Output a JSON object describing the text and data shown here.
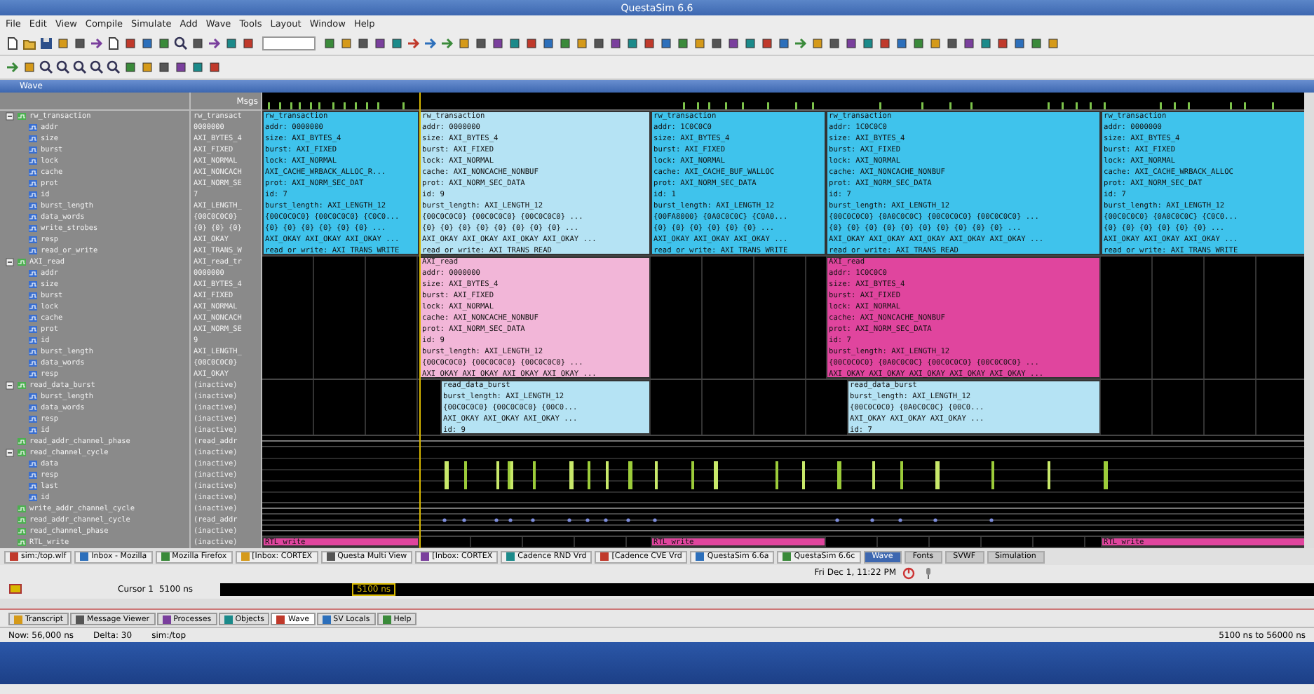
{
  "window": {
    "title": "QuestaSim 6.6"
  },
  "menu": [
    "File",
    "Edit",
    "View",
    "Compile",
    "Simulate",
    "Add",
    "Wave",
    "Tools",
    "Layout",
    "Window",
    "Help"
  ],
  "wave_window": {
    "title": "Wave",
    "value_header": "Msgs"
  },
  "signals": [
    {
      "name": "rw_transaction",
      "value": "rw_transact",
      "expanded": true,
      "wave": {
        "kind": "transactions",
        "segments": [
          {
            "kind": "transaction",
            "color": "#3fc3ec",
            "lines": [
              "rw_transaction",
              "addr: 0000000",
              "size: AXI_BYTES_4",
              "burst: AXI_FIXED",
              "lock: AXI_NORMAL",
              "AXI_CACHE_WRBACK_ALLOC_R...",
              "prot: AXI_NORM_SEC_DAT",
              "id: 7",
              "burst_length: AXI_LENGTH_12",
              "{00C0C0C0} {00C0C0C0} {C0C0...",
              "{0} {0} {0} {0} {0} {0} ...",
              "AXI_OKAY AXI_OKAY AXI_OKAY ...",
              "read_or_write: AXI_TRANS_WRITE"
            ]
          },
          {
            "kind": "transaction",
            "color": "#b5e3f4",
            "lines": [
              "rw_transaction",
              "addr: 0000000",
              "size: AXI_BYTES_4",
              "burst: AXI_FIXED",
              "lock: AXI_NORMAL",
              "cache: AXI_NONCACHE_NONBUF",
              "prot: AXI_NORM_SEC_DATA",
              "id: 9",
              "burst_length: AXI_LENGTH_12",
              "{00C0C0C0} {00C0C0C0} {00C0C0C0} ...",
              "{0} {0} {0} {0} {0} {0} {0} {0} ...",
              "AXI_OKAY AXI_OKAY AXI_OKAY AXI_OKAY ...",
              "read_or_write: AXI_TRANS_READ"
            ]
          },
          {
            "kind": "transaction",
            "color": "#3fc3ec",
            "lines": [
              "rw_transaction",
              "addr: 1C0C0C0",
              "size: AXI_BYTES_4",
              "burst: AXI_FIXED",
              "lock: AXI_NORMAL",
              "cache: AXI_CACHE_BUF_WALLOC",
              "prot: AXI_NORM_SEC_DATA",
              "id: 1",
              "burst_length: AXI_LENGTH_12",
              "{00FA8000} {0A0C0C0C} {C0A0...",
              "{0} {0} {0} {0} {0} {0} ...",
              "AXI_OKAY AXI_OKAY AXI_OKAY ...",
              "read_or_write: AXI_TRANS_WRITE"
            ]
          },
          {
            "kind": "transaction",
            "color": "#3fc3ec",
            "lines": [
              "rw_transaction",
              "addr: 1C0C0C0",
              "size: AXI_BYTES_4",
              "burst: AXI_FIXED",
              "lock: AXI_NORMAL",
              "cache: AXI_NONCACHE_NONBUF",
              "prot: AXI_NORM_SEC_DATA",
              "id: 7",
              "burst_length: AXI_LENGTH_12",
              "{00C0C0C0} {0A0C0C0C} {00C0C0C0} {00C0C0C0} ...",
              "{0} {0} {0} {0} {0} {0} {0} {0} {0} {0} ...",
              "AXI_OKAY AXI_OKAY AXI_OKAY AXI_OKAY AXI_OKAY ...",
              "read_or_write: AXI_TRANS_READ"
            ]
          },
          {
            "kind": "transaction",
            "color": "#3fc3ec",
            "lines": [
              "rw_transaction",
              "addr: 0000000",
              "size: AXI_BYTES_4",
              "burst: AXI_FIXED",
              "lock: AXI_NORMAL",
              "cache: AXI_CACHE_WRBACK_ALLOC",
              "prot: AXI_NORM_SEC_DAT",
              "id: 7",
              "burst_length: AXI_LENGTH_12",
              "{00C0C0C0} {0A0C0C0C} {C0C0...",
              "{0} {0} {0} {0} {0} {0} ...",
              "AXI_OKAY AXI_OKAY AXI_OKAY ...",
              "read_or_write: AXI_TRANS_WRITE"
            ]
          }
        ]
      },
      "children": [
        {
          "name": "addr",
          "value": "0000000"
        },
        {
          "name": "size",
          "value": "AXI_BYTES_4"
        },
        {
          "name": "burst",
          "value": "AXI_FIXED"
        },
        {
          "name": "lock",
          "value": "AXI_NORMAL"
        },
        {
          "name": "cache",
          "value": "AXI_NONCACH"
        },
        {
          "name": "prot",
          "value": "AXI_NORM_SE"
        },
        {
          "name": "id",
          "value": "7"
        },
        {
          "name": "burst_length",
          "value": "AXI_LENGTH_"
        },
        {
          "name": "data_words",
          "value": "{00C0C0C0}"
        },
        {
          "name": "write_strobes",
          "value": "{0} {0} {0}"
        },
        {
          "name": "resp",
          "value": "AXI_OKAY"
        },
        {
          "name": "read_or_write",
          "value": "AXI_TRANS_W"
        }
      ]
    },
    {
      "name": "AXI_read",
      "value": "AXI_read_tr",
      "expanded": true,
      "wave": {
        "kind": "transactions",
        "segments": [
          {
            "kind": "idle"
          },
          {
            "kind": "transaction",
            "color": "#f2b6d8",
            "lines": [
              "AXI_read",
              "addr: 0000000",
              "size: AXI_BYTES_4",
              "burst: AXI_FIXED",
              "lock: AXI_NORMAL",
              "cache: AXI_NONCACHE_NONBUF",
              "prot: AXI_NORM_SEC_DATA",
              "id: 9",
              "burst_length: AXI_LENGTH_12",
              "{00C0C0C0} {00C0C0C0} {00C0C0C0} ...",
              "AXI_OKAY AXI_OKAY AXI_OKAY AXI_OKAY ..."
            ]
          },
          {
            "kind": "idle"
          },
          {
            "kind": "transaction",
            "color": "#e0459e",
            "lines": [
              "AXI_read",
              "addr: 1C0C0C0",
              "size: AXI_BYTES_4",
              "burst: AXI_FIXED",
              "lock: AXI_NORMAL",
              "cache: AXI_NONCACHE_NONBUF",
              "prot: AXI_NORM_SEC_DATA",
              "id: 7",
              "burst_length: AXI_LENGTH_12",
              "{00C0C0C0} {0A0C0C0C} {00C0C0C0} {00C0C0C0} ...",
              "AXI_OKAY AXI_OKAY AXI_OKAY AXI_OKAY AXI_OKAY ..."
            ]
          },
          {
            "kind": "idle"
          }
        ]
      },
      "children": [
        {
          "name": "addr",
          "value": "0000000"
        },
        {
          "name": "size",
          "value": "AXI_BYTES_4"
        },
        {
          "name": "burst",
          "value": "AXI_FIXED"
        },
        {
          "name": "lock",
          "value": "AXI_NORMAL"
        },
        {
          "name": "cache",
          "value": "AXI_NONCACH"
        },
        {
          "name": "prot",
          "value": "AXI_NORM_SE"
        },
        {
          "name": "id",
          "value": "9"
        },
        {
          "name": "burst_length",
          "value": "AXI_LENGTH_"
        },
        {
          "name": "data_words",
          "value": "{00C0C0C0}"
        },
        {
          "name": "resp",
          "value": "AXI_OKAY"
        }
      ]
    },
    {
      "name": "read_data_burst",
      "value": "(inactive)",
      "expanded": true,
      "wave": {
        "kind": "bursts",
        "segments": [
          {
            "kind": "idle"
          },
          {
            "kind": "transaction",
            "color": "#b5e3f4",
            "lines": [
              "read_data_burst",
              "burst_length: AXI_LENGTH_12",
              "{00C0C0C0} {00C0C0C0} {00C0...",
              "AXI_OKAY AXI_OKAY AXI_OKAY ...",
              "id: 9"
            ]
          },
          {
            "kind": "idle"
          },
          {
            "kind": "transaction",
            "color": "#b5e3f4",
            "lines": [
              "read_data_burst",
              "burst_length: AXI_LENGTH_12",
              "{00C0C0C0} {0A0C0C0C} {00C0...",
              "AXI_OKAY AXI_OKAY AXI_OKAY ...",
              "id: 7"
            ]
          },
          {
            "kind": "idle"
          }
        ]
      },
      "children": [
        {
          "name": "burst_length",
          "value": "(inactive)"
        },
        {
          "name": "data_words",
          "value": "(inactive)"
        },
        {
          "name": "resp",
          "value": "(inactive)"
        },
        {
          "name": "id",
          "value": "(inactive)"
        }
      ]
    },
    {
      "name": "read_addr_channel_phase",
      "value": "(read_addr",
      "wave": {
        "kind": "line"
      }
    },
    {
      "name": "read_channel_cycle",
      "value": "(inactive)",
      "expanded": true,
      "wave": {
        "kind": "pulses"
      },
      "children": [
        {
          "name": "data",
          "value": "(inactive)"
        },
        {
          "name": "resp",
          "value": "(inactive)"
        },
        {
          "name": "last",
          "value": "(inactive)"
        },
        {
          "name": "id",
          "value": "(inactive)"
        }
      ]
    },
    {
      "name": "write_addr_channel_cycle",
      "value": "(inactive)",
      "wave": {
        "kind": "line"
      }
    },
    {
      "name": "read_addr_channel_cycle",
      "value": "(read_addr",
      "wave": {
        "kind": "dots"
      }
    },
    {
      "name": "read_channel_phase",
      "value": "(inactive)",
      "wave": {
        "kind": "line"
      }
    },
    {
      "name": "RTL_write",
      "value": "(inactive)",
      "wave": {
        "kind": "transactions",
        "segments": [
          {
            "kind": "transaction",
            "color": "#e0459e",
            "lines": [
              "RTL_write"
            ]
          },
          {
            "kind": "idle"
          },
          {
            "kind": "transaction",
            "color": "#e0459e",
            "lines": [
              "RTL_write"
            ]
          },
          {
            "kind": "idle"
          },
          {
            "kind": "transaction",
            "color": "#e0459e",
            "lines": [
              "RTL_write"
            ]
          }
        ]
      }
    }
  ],
  "window_buttons": [
    {
      "label": "sim:/top.wlf"
    },
    {
      "label": "Inbox - Mozilla"
    },
    {
      "label": "Mozilla Firefox"
    },
    {
      "label": "[Inbox: CORTEX"
    },
    {
      "label": "Questa Multi View"
    },
    {
      "label": "[Inbox: CORTEX"
    },
    {
      "label": "Cadence RND Vrd"
    },
    {
      "label": "[Cadence CVE Vrd"
    },
    {
      "label": "QuestaSim 6.6a"
    },
    {
      "label": "QuestaSim 6.6c"
    }
  ],
  "workspaces": [
    {
      "label": "Wave",
      "selected": true
    },
    {
      "label": "Fonts",
      "selected": false
    },
    {
      "label": "SVWF",
      "selected": false
    },
    {
      "label": "Simulation",
      "selected": false
    }
  ],
  "clock": "Fri Dec 1, 11:22 PM",
  "cursor": {
    "label": "Cursor 1",
    "value": "5100 ns",
    "marker": "5100 ns"
  },
  "bottom_tabs": [
    {
      "label": "Transcript",
      "selected": false
    },
    {
      "label": "Message Viewer",
      "selected": false
    },
    {
      "label": "Processes",
      "selected": false
    },
    {
      "label": "Objects",
      "selected": false
    },
    {
      "label": "Wave",
      "selected": true
    },
    {
      "label": "SV Locals",
      "selected": false
    },
    {
      "label": "Help",
      "selected": false
    }
  ],
  "status_bar": {
    "now": "Now: 56,000 ns",
    "delta": "Delta: 30",
    "context": "sim:/top",
    "range": "5100 ns to 56000 ns"
  }
}
